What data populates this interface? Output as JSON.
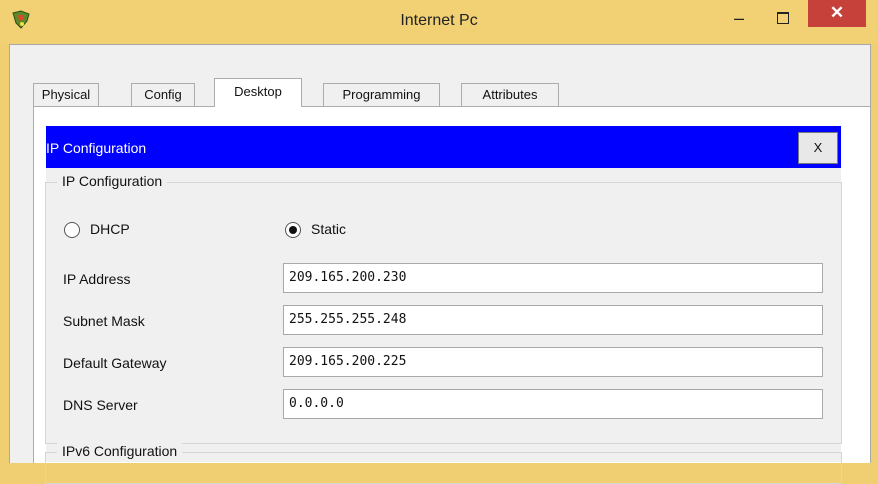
{
  "window": {
    "title": "Internet Pc",
    "minimize_glyph": "–",
    "close_glyph": "✕"
  },
  "tabs": [
    {
      "label": "Physical"
    },
    {
      "label": "Config"
    },
    {
      "label": "Desktop",
      "active": true
    },
    {
      "label": "Programming"
    },
    {
      "label": "Attributes"
    }
  ],
  "ip_config_panel": {
    "title": "IP Configuration",
    "close_label": "X",
    "header_color": "#0000ff"
  },
  "ipv4_group": {
    "legend": "IP Configuration",
    "mode_options": [
      {
        "label": "DHCP",
        "selected": false
      },
      {
        "label": "Static",
        "selected": true
      }
    ],
    "fields": {
      "ip_address": {
        "label": "IP Address",
        "value": "209.165.200.230"
      },
      "subnet_mask": {
        "label": "Subnet Mask",
        "value": "255.255.255.248"
      },
      "default_gateway": {
        "label": "Default Gateway",
        "value": "209.165.200.225"
      },
      "dns_server": {
        "label": "DNS Server",
        "value": "0.0.0.0"
      }
    }
  },
  "ipv6_group": {
    "legend": "IPv6 Configuration"
  },
  "colors": {
    "titlebar": "#f2d074",
    "close_button": "#c7413b"
  },
  "icons": {
    "app": "packet-tracer-app-icon",
    "maximize": "maximize-icon"
  }
}
